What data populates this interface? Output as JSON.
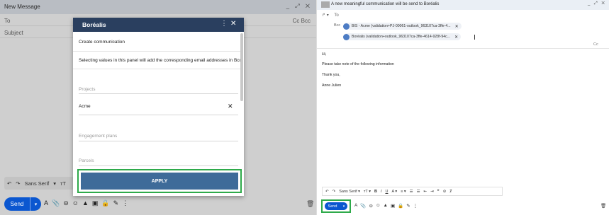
{
  "left_compose": {
    "title": "New Message",
    "window_controls": "_ ⤢ ✕",
    "to_label": "To",
    "cc_bcc_label": "Cc Bcc",
    "subject_placeholder": "Subject",
    "format_bar": {
      "undo": "↶",
      "redo": "↷",
      "font": "Sans Serif",
      "font_caret": "▾",
      "size": "тT"
    },
    "send_label": "Send",
    "send_more": "▾",
    "tools": [
      "A",
      "📎",
      "⊝",
      "☺",
      "▲",
      "▣",
      "🔒",
      "✎",
      "⋮"
    ],
    "trash": "🗑"
  },
  "panel": {
    "title": "Boréalis",
    "more_icon": "⋮",
    "close_icon": "✕",
    "heading": "Create communication",
    "description": "Selecting values in this panel will add the corresponding email addresses in Bcc.",
    "projects_label": "Projects",
    "selected_project": "Acme",
    "remove_icon": "✕",
    "engagement_label": "Engagement plans",
    "parcels_label": "Parcels",
    "apply_label": "APPLY"
  },
  "right_compose": {
    "title": "A new meaningful communication will be send to Boréalis",
    "window_controls": "_ ⤢ ✕",
    "reply_icon": "↱ ▾",
    "to_label": "To",
    "bcc_label": "Bcc",
    "bcc_chips": [
      "BIS - Acme (validation+PJ-00061-outlook_963107ca-3ffe-4...",
      "Boréalis (validation+outlook_963107ca-3ffe-4614-928f-94c..."
    ],
    "chip_remove": "✕",
    "cc_label": "Cc",
    "body": [
      "Hi,",
      "Please take note of the following information",
      "Thank you,",
      "Anne Julien"
    ],
    "format_items": [
      "↶",
      "↷",
      "Sans Serif ▾",
      "тT ▾",
      "B",
      "I",
      "U",
      "A ▾",
      "≡ ▾",
      "☰",
      "☰",
      "⇤",
      "⇥",
      "❞",
      "⊘",
      "Ⱦ"
    ],
    "send_label": "Send",
    "send_more": "▾",
    "tools": [
      "A",
      "📎",
      "⊝",
      "☺",
      "▲",
      "▣",
      "🔒",
      "✎",
      "⋮"
    ],
    "trash": "🗑"
  },
  "colors": {
    "panel_header": "#2a3f5f",
    "apply_button": "#3e6b99",
    "highlight": "#2eaa4a",
    "send": "#0b57d0"
  }
}
